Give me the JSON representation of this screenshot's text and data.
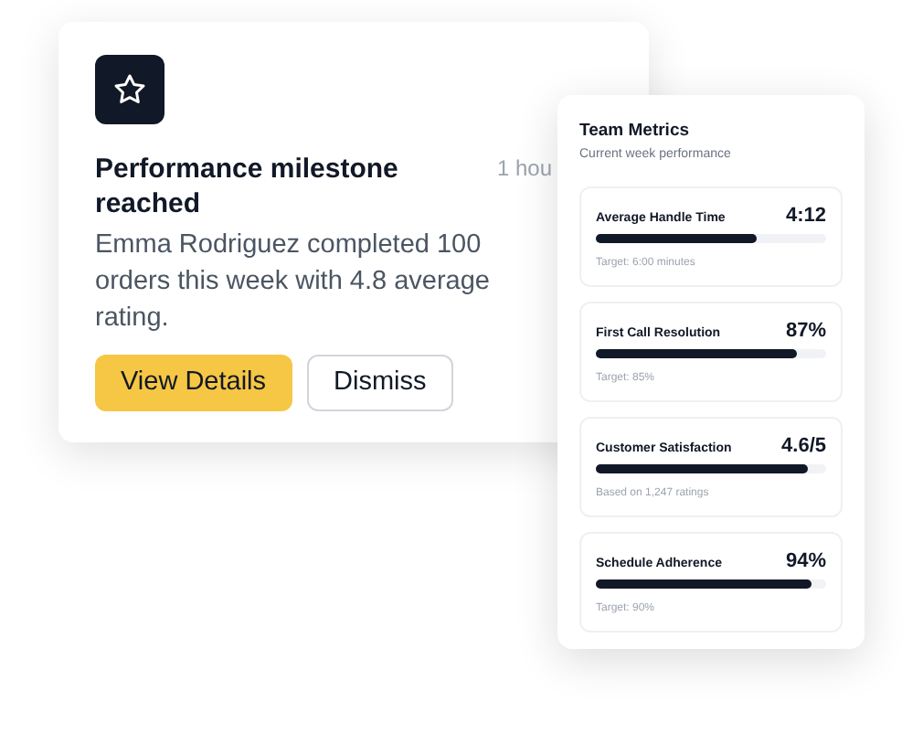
{
  "notification": {
    "title": "Performance milestone reached",
    "time": "1 hou",
    "message": "Emma Rodriguez completed 100 orders this week with 4.8 average rating.",
    "buttons": [
      {
        "label": "View Details",
        "kind": "primary"
      },
      {
        "label": "Dismiss",
        "kind": "secondary"
      }
    ]
  },
  "metrics_panel": {
    "title": "Team Metrics",
    "subtitle": "Current week performance",
    "metrics": [
      {
        "name": "Average Handle Time",
        "value": "4:12",
        "level": 0.7,
        "note": "Target: 6:00 minutes"
      },
      {
        "name": "First Call Resolution",
        "value": "87%",
        "level": 0.87,
        "note": "Target: 85%"
      },
      {
        "name": "Customer Satisfaction",
        "value": "4.6/5",
        "level": 0.92,
        "note": "Based on 1,247 ratings"
      },
      {
        "name": "Schedule Adherence",
        "value": "94%",
        "level": 0.94,
        "note": "Target: 90%"
      }
    ]
  }
}
